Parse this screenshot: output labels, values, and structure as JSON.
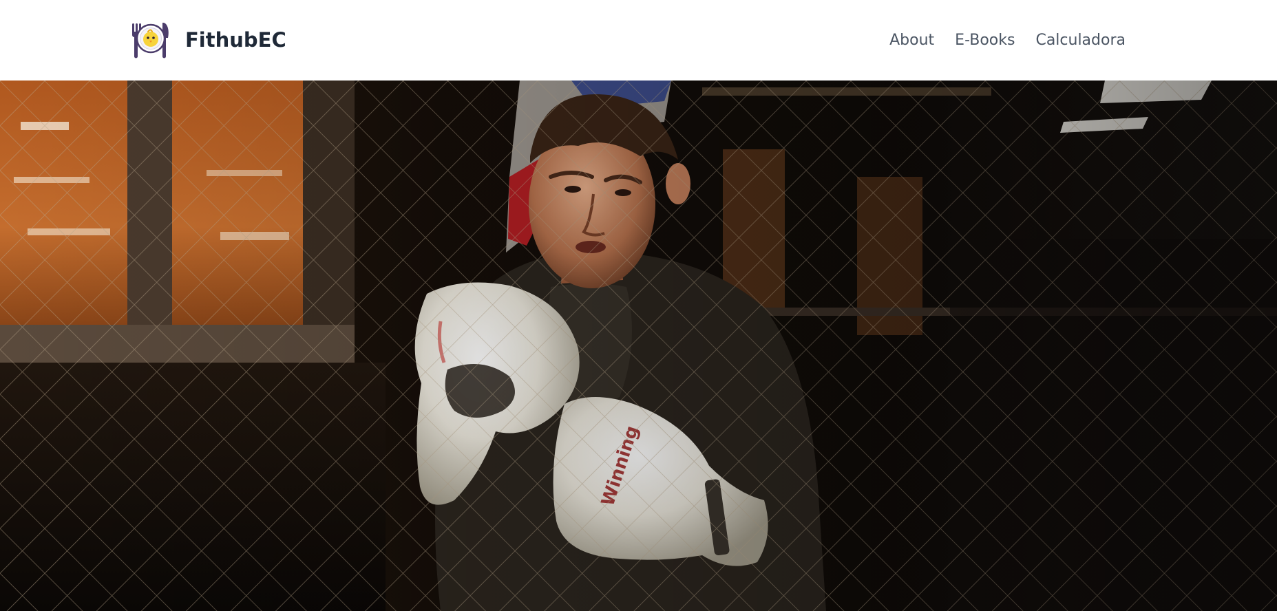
{
  "navbar": {
    "brand_name": "FithubEC",
    "logo_icon": "chick-plate-cutlery-icon",
    "links": [
      {
        "label": "About"
      },
      {
        "label": "E-Books"
      },
      {
        "label": "Calculadora"
      }
    ]
  },
  "hero": {
    "media": "boxer-in-cage-video",
    "colors": {
      "background": "#0d0906",
      "glove": "#f2efe6",
      "window_glow": "#c0652a"
    }
  }
}
